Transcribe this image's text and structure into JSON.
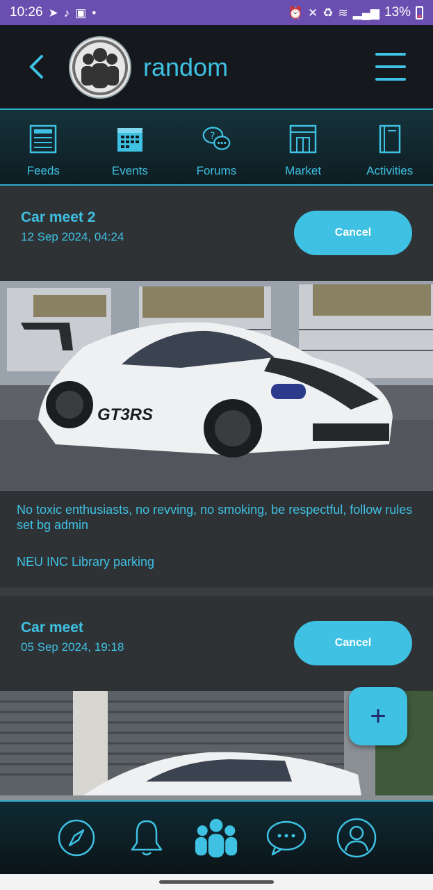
{
  "status_bar": {
    "time": "10:26",
    "battery_percent": "13%",
    "left_icons": [
      "telegram-icon",
      "tiktok-icon",
      "gallery-icon",
      "dot-icon"
    ],
    "right_icons": [
      "alarm-icon",
      "mute-icon",
      "battery-saver-icon",
      "wifi-icon",
      "signal-icon",
      "battery-icon"
    ]
  },
  "header": {
    "title": "random"
  },
  "tabs": [
    {
      "label": "Feeds",
      "icon": "feeds-icon"
    },
    {
      "label": "Events",
      "icon": "events-icon"
    },
    {
      "label": "Forums",
      "icon": "forums-icon"
    },
    {
      "label": "Market",
      "icon": "market-icon"
    },
    {
      "label": "Activities",
      "icon": "activities-icon"
    }
  ],
  "events": [
    {
      "title": "Car meet 2",
      "date": "12 Sep 2024, 04:24",
      "button_label": "Cancel",
      "description": "No toxic enthusiasts, no revving, no smoking, be respectful, follow rules set bg admin",
      "location": "NEU INC Library parking"
    },
    {
      "title": "Car meet",
      "date": "05 Sep 2024, 19:18",
      "button_label": "Cancel"
    }
  ],
  "fab": {
    "label": "+"
  },
  "bottom_nav": [
    "compass-icon",
    "bell-icon",
    "groups-icon",
    "chat-icon",
    "profile-icon"
  ],
  "colors": {
    "accent": "#3ec1e2",
    "header_bg": "#15191d",
    "card_bg": "#2f3235",
    "status_bar": "#6a4fb0"
  }
}
